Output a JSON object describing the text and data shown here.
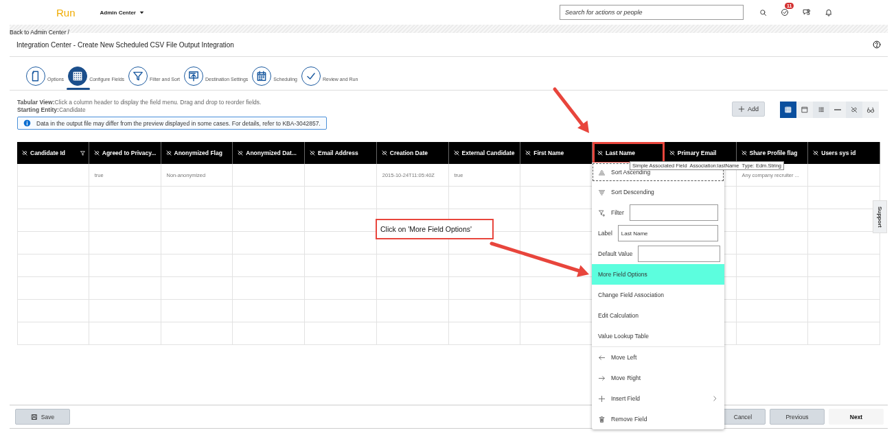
{
  "header": {
    "logo": "Run",
    "menu": "Admin Center",
    "search": {
      "placeholder": "Search for actions or people"
    },
    "tasks_badge": "11"
  },
  "breadcrumb": "Back to Admin Center /",
  "page_title": "Integration Center - Create New Scheduled CSV File Output Integration",
  "steps": [
    {
      "label": "Options",
      "kind": "document",
      "selected": false
    },
    {
      "label": "Configure Fields",
      "kind": "grid",
      "selected": true
    },
    {
      "label": "Filter and Sort",
      "kind": "funnel",
      "selected": false
    },
    {
      "label": "Destination Settings",
      "kind": "upload",
      "selected": false
    },
    {
      "label": "Scheduling",
      "kind": "calendar",
      "selected": false
    },
    {
      "label": "Review and Run",
      "kind": "check",
      "selected": false
    }
  ],
  "instructions": [
    "**Tabular View:**Click a column header to display the field menu. Drag and drop to reorder fields.",
    "**Starting Entity:**Candidate"
  ],
  "info_banner": "Data in the output file may differ from the preview displayed in some cases. For details, refer to KBA-3042857.",
  "toolbar": {
    "add_button": "Add",
    "views": [
      {
        "kind": "grid",
        "selected": true
      },
      {
        "kind": "window",
        "selected": false
      },
      {
        "kind": "list",
        "selected": false
      },
      {
        "kind": "underline",
        "selected": false
      },
      {
        "kind": "link-off",
        "selected": false
      },
      {
        "kind": "glasses",
        "selected": false
      }
    ]
  },
  "table": {
    "columns": [
      {
        "label": "Candidate Id",
        "filter": true,
        "highlighted": false
      },
      {
        "label": "Agreed to Privacy...",
        "filter": false,
        "highlighted": false
      },
      {
        "label": "Anonymized Flag",
        "filter": false,
        "highlighted": false
      },
      {
        "label": "Anonymized Dat...",
        "filter": false,
        "highlighted": false
      },
      {
        "label": "Email Address",
        "filter": false,
        "highlighted": false
      },
      {
        "label": "Creation Date",
        "filter": false,
        "highlighted": false
      },
      {
        "label": "External Candidate",
        "filter": false,
        "highlighted": false
      },
      {
        "label": "First Name",
        "filter": false,
        "highlighted": false
      },
      {
        "label": "Last Name",
        "filter": false,
        "highlighted": true
      },
      {
        "label": "Primary Email",
        "filter": false,
        "highlighted": false
      },
      {
        "label": "Share Profile flag",
        "filter": false,
        "highlighted": false
      },
      {
        "label": "Users sys id",
        "filter": false,
        "highlighted": false
      }
    ],
    "rows": [
      {
        "cells": [
          null,
          "true",
          "Non-anonymized",
          null,
          null,
          "2015-10-24T11:05:40Z",
          "true",
          null,
          null,
          null,
          "Any company recruiter ...",
          null
        ]
      },
      {
        "cells": [
          null,
          null,
          null,
          null,
          null,
          null,
          null,
          null,
          null,
          null,
          null,
          null
        ]
      },
      {
        "cells": [
          null,
          null,
          null,
          null,
          null,
          null,
          null,
          null,
          null,
          null,
          null,
          null
        ]
      },
      {
        "cells": [
          null,
          null,
          null,
          null,
          null,
          null,
          null,
          null,
          null,
          null,
          null,
          null
        ]
      },
      {
        "cells": [
          null,
          null,
          null,
          null,
          null,
          null,
          null,
          null,
          null,
          null,
          null,
          null
        ]
      },
      {
        "cells": [
          null,
          null,
          null,
          null,
          null,
          null,
          null,
          null,
          null,
          null,
          null,
          null
        ]
      },
      {
        "cells": [
          null,
          null,
          null,
          null,
          null,
          null,
          null,
          null,
          null,
          null,
          null,
          null
        ]
      },
      {
        "cells": [
          null,
          null,
          null,
          null,
          null,
          null,
          null,
          null,
          null,
          null,
          null,
          null
        ]
      }
    ]
  },
  "tooltip": "Simple Associated Field  Association:lastName  Type: Edm.String",
  "field_menu": {
    "items": [
      {
        "kind": "sort-ascending",
        "label": "Sort Ascending",
        "focused": true,
        "highlighted": false,
        "submenu": false
      },
      {
        "kind": "sort-descending",
        "label": "Sort Descending",
        "focused": false,
        "highlighted": false,
        "submenu": false
      },
      {
        "kind": "filter-field",
        "label": "Filter"
      },
      {
        "kind": "text-field",
        "label": "Label",
        "value": "Last Name"
      },
      {
        "kind": "text-field",
        "label": "Default Value"
      },
      {
        "kind": "option",
        "label": "More Field Options",
        "focused": false,
        "highlighted": true,
        "submenu": false
      },
      {
        "kind": "option",
        "label": "Change Field Association",
        "focused": false,
        "highlighted": false,
        "submenu": false
      },
      {
        "kind": "option",
        "label": "Edit Calculation",
        "focused": false,
        "highlighted": false,
        "submenu": false
      },
      {
        "kind": "option",
        "label": "Value Lookup Table",
        "focused": false,
        "highlighted": false,
        "submenu": false
      },
      {
        "kind": "divider"
      },
      {
        "kind": "move-left",
        "label": "Move Left",
        "focused": false,
        "highlighted": false,
        "submenu": false
      },
      {
        "kind": "move-right",
        "label": "Move Right",
        "focused": false,
        "highlighted": false,
        "submenu": false
      },
      {
        "kind": "insert",
        "label": "Insert Field",
        "submenu": true,
        "focused": false,
        "highlighted": false
      },
      {
        "kind": "remove",
        "label": "Remove Field",
        "focused": false,
        "highlighted": false,
        "submenu": false
      }
    ]
  },
  "callout": "Click on 'More Field Options'",
  "support_tab": "Support",
  "footer": {
    "save": "Save",
    "buttons": [
      {
        "label": "Cancel",
        "kind": "secondary"
      },
      {
        "label": "Previous",
        "kind": "secondary"
      },
      {
        "label": "Next",
        "kind": "primary"
      }
    ]
  }
}
